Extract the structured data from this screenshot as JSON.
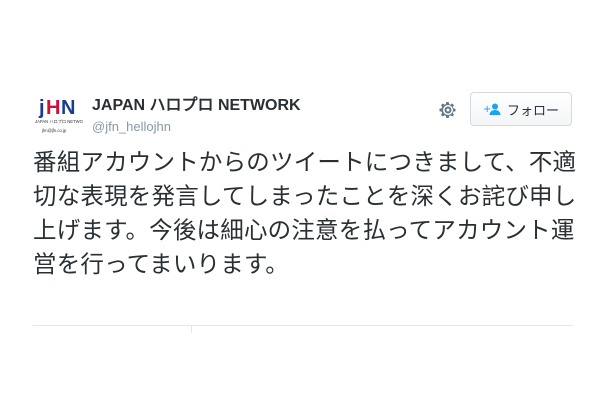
{
  "account": {
    "display_name": "JAPAN ハロプロ NETWORK",
    "screen_name": "@jfn_hellojhn",
    "avatar_logo_text": "jHN",
    "avatar_sub_text": "JAPAN ハロプロ NETWORK",
    "avatar_url_text": "jhn@jfn.co.jp"
  },
  "actions": {
    "settings_icon": "gear-icon",
    "follow_label": "フォロー",
    "follow_icon": "add-user-icon"
  },
  "tweet": {
    "text": "番組アカウントからのツイートにつきまして、不適切な表現を発言してしまったことを深くお詫び申し上げます。今後は細心の注意を払ってアカウント運営を行ってまいります。"
  },
  "colors": {
    "text": "#292f33",
    "muted": "#8899a6",
    "border": "#e1e8ed",
    "logo_blue": "#1a3c8f",
    "logo_red": "#d0103a"
  }
}
